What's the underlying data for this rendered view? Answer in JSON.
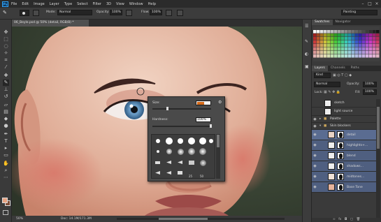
{
  "app": {
    "logo": "Ps"
  },
  "menu": [
    "File",
    "Edit",
    "Image",
    "Layer",
    "Type",
    "Select",
    "Filter",
    "3D",
    "View",
    "Window",
    "Help"
  ],
  "window_controls": [
    "–",
    "□",
    "×"
  ],
  "options": {
    "mode_label": "Mode:",
    "mode_value": "Normal",
    "opacity_label": "Opacity:",
    "opacity_value": "100%",
    "flow_label": "Flow:",
    "flow_value": "100%",
    "workspace": "Painting"
  },
  "document": {
    "tab_title": "06_Beyle.psd @ 50% (detail, RGB/8) *",
    "zoom": "50%",
    "doc_info": "Doc: 14.1M/171.3M"
  },
  "brush_picker": {
    "size_label": "Size:",
    "hardness_label": "Hardness:",
    "hardness_value": "100%",
    "preset_numbers": [
      "25",
      "50"
    ]
  },
  "panels": {
    "swatch_tabs": [
      "Swatches",
      "Navigator"
    ],
    "layer_tabs": [
      "Layers",
      "Channels",
      "Paths"
    ],
    "kind_label": "Kind",
    "blend_mode": "Normal",
    "opacity_label": "Opacity:",
    "opacity_value": "100%",
    "lock_label": "Lock:",
    "fill_label": "Fill:",
    "fill_value": "100%",
    "layers": [
      {
        "name": "sketch"
      },
      {
        "name": "light source"
      },
      {
        "name": "Palette"
      },
      {
        "name": "Skin blockers"
      },
      {
        "name": "detail"
      },
      {
        "name": "highlights+..."
      },
      {
        "name": "blend"
      },
      {
        "name": "shadows..."
      },
      {
        "name": "midtones..."
      },
      {
        "name": "Base Tone"
      }
    ]
  },
  "colors": {
    "accent": "#31a8ff",
    "selected_layer": "#5a6c91",
    "foreground": "#e8a382",
    "background": "#7a4a35"
  }
}
